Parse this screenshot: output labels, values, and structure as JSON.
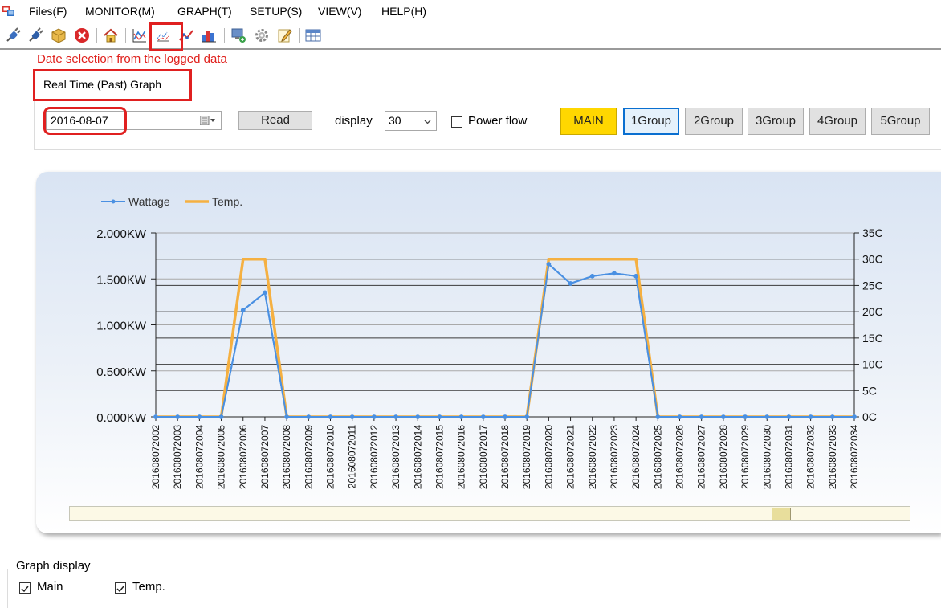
{
  "menu": [
    "Files(F)",
    "MONITOR(M)",
    "GRAPH(T)",
    "SETUP(S)",
    "VIEW(V)",
    "HELP(H)"
  ],
  "toolbar_icons": [
    "connect-plug-icon",
    "disconnect-plug-icon",
    "package-icon",
    "stop-icon",
    "home-icon",
    "monitor-graph-icon",
    "past-graph-icon",
    "line-graph-icon",
    "bar-chart-icon",
    "display-settings-icon",
    "gear-icon",
    "edit-icon",
    "table-view-icon"
  ],
  "annotation": {
    "hint": "Date selection from the logged data",
    "accent": "#e02020"
  },
  "past_graph": {
    "title": "Real Time (Past) Graph",
    "date": "2016-08-07",
    "read_label": "Read",
    "display_label": "display",
    "display_value": "30",
    "power_flow_label": "Power flow",
    "power_flow_checked": false,
    "groups": [
      "MAIN",
      "1Group",
      "2Group",
      "3Group",
      "4Group",
      "5Group"
    ],
    "active_group": "MAIN",
    "focused_group": "1Group",
    "active_color": "#ffd700"
  },
  "chart_data": {
    "type": "line",
    "legend": [
      {
        "name": "Wattage",
        "color": "#4a90e2"
      },
      {
        "name": "Temp.",
        "color": "#f5b041"
      }
    ],
    "x": [
      "201608072002",
      "201608072003",
      "201608072004",
      "201608072005",
      "201608072006",
      "201608072007",
      "201608072008",
      "201608072009",
      "201608072010",
      "201608072011",
      "201608072012",
      "201608072013",
      "201608072014",
      "201608072015",
      "201608072016",
      "201608072017",
      "201608072018",
      "201608072019",
      "201608072020",
      "201608072021",
      "201608072022",
      "201608072023",
      "201608072024",
      "201608072025",
      "201608072026",
      "201608072027",
      "201608072028",
      "201608072029",
      "201608072030",
      "201608072031",
      "201608072032",
      "201608072033",
      "201608072034"
    ],
    "series": [
      {
        "name": "Wattage",
        "axis": "left",
        "values": [
          0,
          0,
          0,
          0,
          1.16,
          1.35,
          0,
          0,
          0,
          0,
          0,
          0,
          0,
          0,
          0,
          0,
          0,
          0,
          1.66,
          1.45,
          1.53,
          1.56,
          1.53,
          0,
          0,
          0,
          0,
          0,
          0,
          0,
          0,
          0,
          0
        ]
      },
      {
        "name": "Temp.",
        "axis": "right",
        "values": [
          0,
          0,
          0,
          0,
          30,
          30,
          0,
          0,
          0,
          0,
          0,
          0,
          0,
          0,
          0,
          0,
          0,
          0,
          30,
          30,
          30,
          30,
          30,
          0,
          0,
          0,
          0,
          0,
          0,
          0,
          0,
          0,
          0
        ]
      }
    ],
    "y_left": {
      "ylim": [
        0,
        2
      ],
      "ticks": [
        "0.000KW",
        "0.500KW",
        "1.000KW",
        "1.500KW",
        "2.000KW"
      ]
    },
    "y_right": {
      "ylim": [
        0,
        35
      ],
      "ticks": [
        "0C",
        "5C",
        "10C",
        "15C",
        "20C",
        "25C",
        "30C",
        "35C"
      ]
    },
    "grid": true,
    "legend_position": "top-left"
  },
  "graph_display": {
    "title": "Graph display",
    "options": [
      {
        "label": "Main",
        "checked": true
      },
      {
        "label": "Temp.",
        "checked": true
      }
    ]
  }
}
